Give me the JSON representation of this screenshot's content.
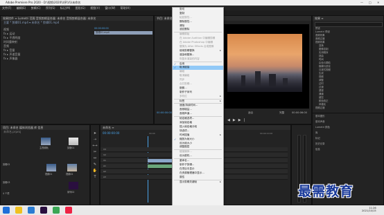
{
  "window": {
    "title": "Adobe Premiere Pro 2020 - D:\\视频\\2020\\\\\\序\\\\\\\\\\\\未命名",
    "minimize": "—",
    "maximize": "□",
    "close": "✕"
  },
  "menubar": [
    "文件(F)",
    "编辑(E)",
    "剪辑(C)",
    "序列(S)",
    "标记(M)",
    "图形(G)",
    "视图(V)",
    "窗口(W)",
    "帮助(H)"
  ],
  "source_panel": {
    "tabs": "效果控件 ≡   Lumetri 范围   音频剪辑混合器: 未命名   音频剪辑混合器: 未命名",
    "clip_path": "主要 * 剪辑01.mp4 ▾   未命名 * 剪辑01.mp4",
    "timecode_start": "00:00:00:00",
    "clip_label": "剪辑01.mp4",
    "rows": [
      "视频",
      "fx ▸ 运动",
      "fx ▸ 不透明度",
      "  时间重映射",
      "音频",
      "fx ▸ 音量",
      "fx ▸ 声道音量",
      "fx ▸ 声像器"
    ]
  },
  "program_panel": {
    "tab": "节目: 未命名 ≡",
    "timecode": "00:00:00:00",
    "fit": "适合",
    "full": "完整",
    "duration": "00:00:06:00"
  },
  "project_panel": {
    "tabs": "项目: 未命名   媒体浏览器   库   信息",
    "search_placeholder": "未命名.prproj",
    "items": [
      "主视频轨",
      "剪辑01",
      "剪辑02",
      "视频01",
      "视频02",
      "序列02",
      "剪辑03"
    ],
    "count": "4 个项"
  },
  "timeline": {
    "tab": "未命名 ≡",
    "timecode": "00:00:00:00",
    "tracks": [
      "V3",
      "V2",
      "V1",
      "A1",
      "A2",
      "A3"
    ],
    "ruler": [
      "00:00",
      "00:00:05:00",
      "00:00:10:00"
    ]
  },
  "effects_panel": {
    "tab": "效果 ≡",
    "tree": [
      "预设",
      "Lumetri 预设",
      "音频效果",
      "音频过渡",
      "视频效果",
      "变换",
      "图像控制",
      "实用程序",
      "扭曲",
      "时间",
      "杂色与颗粒",
      "模糊与锐化",
      "沉浸式视频",
      "生成",
      "视频",
      "调整",
      "过时",
      "过渡",
      "透视",
      "通道",
      "键控",
      "颜色校正",
      "风格化",
      "视频过渡"
    ],
    "sections": [
      "基本图形",
      "基本声音",
      "Lumetri 颜色",
      "库",
      "标记",
      "历史记录",
      "信息"
    ]
  },
  "context_menu": {
    "items": [
      {
        "label": "剪切",
        "state": "normal"
      },
      {
        "label": "复制",
        "state": "normal"
      },
      {
        "label": "粘贴属性...",
        "state": "disabled"
      },
      {
        "label": "删除属性...",
        "state": "normal"
      },
      {
        "label": "清除",
        "state": "normal"
      },
      {
        "label": "波纹删除",
        "state": "normal"
      },
      {
        "sep": true
      },
      {
        "label": "编辑原始",
        "state": "disabled"
      },
      {
        "label": "在 Adobe Audition 中编辑剪辑",
        "state": "disabled"
      },
      {
        "label": "在 Adobe Photoshop 中编辑",
        "state": "disabled"
      },
      {
        "label": "替换为 After Effects 合成图像",
        "state": "disabled"
      },
      {
        "label": "使用剪辑替换",
        "state": "normal",
        "sub": true
      },
      {
        "label": "渲染和替换...",
        "state": "normal"
      },
      {
        "label": "恢复未渲染的内容",
        "state": "disabled"
      },
      {
        "sep": true
      },
      {
        "label": "启用",
        "state": "normal",
        "checked": true
      },
      {
        "label": "取消链接",
        "state": "highlight",
        "checked": true
      },
      {
        "label": "编组",
        "state": "disabled"
      },
      {
        "label": "取消编组",
        "state": "disabled"
      },
      {
        "label": "同步",
        "state": "disabled"
      },
      {
        "label": "合并剪辑...",
        "state": "disabled"
      },
      {
        "label": "嵌套...",
        "state": "normal"
      },
      {
        "label": "制作子序列",
        "state": "normal"
      },
      {
        "label": "多机位",
        "state": "disabled",
        "sub": true
      },
      {
        "sep": true
      },
      {
        "label": "标签",
        "state": "normal",
        "sub": true
      },
      {
        "sep": true
      },
      {
        "label": "速度/持续时间...",
        "state": "normal"
      },
      {
        "label": "音频增益...",
        "state": "normal"
      },
      {
        "label": "音频声道...",
        "state": "normal"
      },
      {
        "sep": true
      },
      {
        "label": "帧定格选项...",
        "state": "normal"
      },
      {
        "label": "添加帧定格",
        "state": "normal"
      },
      {
        "label": "插入帧定格分段",
        "state": "normal"
      },
      {
        "label": "场选项...",
        "state": "normal"
      },
      {
        "label": "时间插值",
        "state": "normal",
        "sub": true
      },
      {
        "label": "缩放为帧大小",
        "state": "normal",
        "checked": true
      },
      {
        "label": "设为帧大小",
        "state": "normal"
      },
      {
        "label": "调整图层",
        "state": "normal"
      },
      {
        "sep": true
      },
      {
        "label": "链接媒体...",
        "state": "disabled"
      },
      {
        "label": "设为脱机...",
        "state": "normal"
      },
      {
        "sep": true
      },
      {
        "label": "重命名...",
        "state": "normal"
      },
      {
        "label": "制作子剪辑...",
        "state": "normal"
      },
      {
        "label": "在项目中显示",
        "state": "normal"
      },
      {
        "label": "在资源管理器中显示...",
        "state": "normal"
      },
      {
        "label": "属性",
        "state": "normal"
      },
      {
        "sep": true
      },
      {
        "label": "显示剪辑关键帧",
        "state": "normal",
        "sub": true
      }
    ]
  },
  "watermark": "最需教育",
  "taskbar": {
    "time": "11:26",
    "date": "2021/10/15"
  }
}
